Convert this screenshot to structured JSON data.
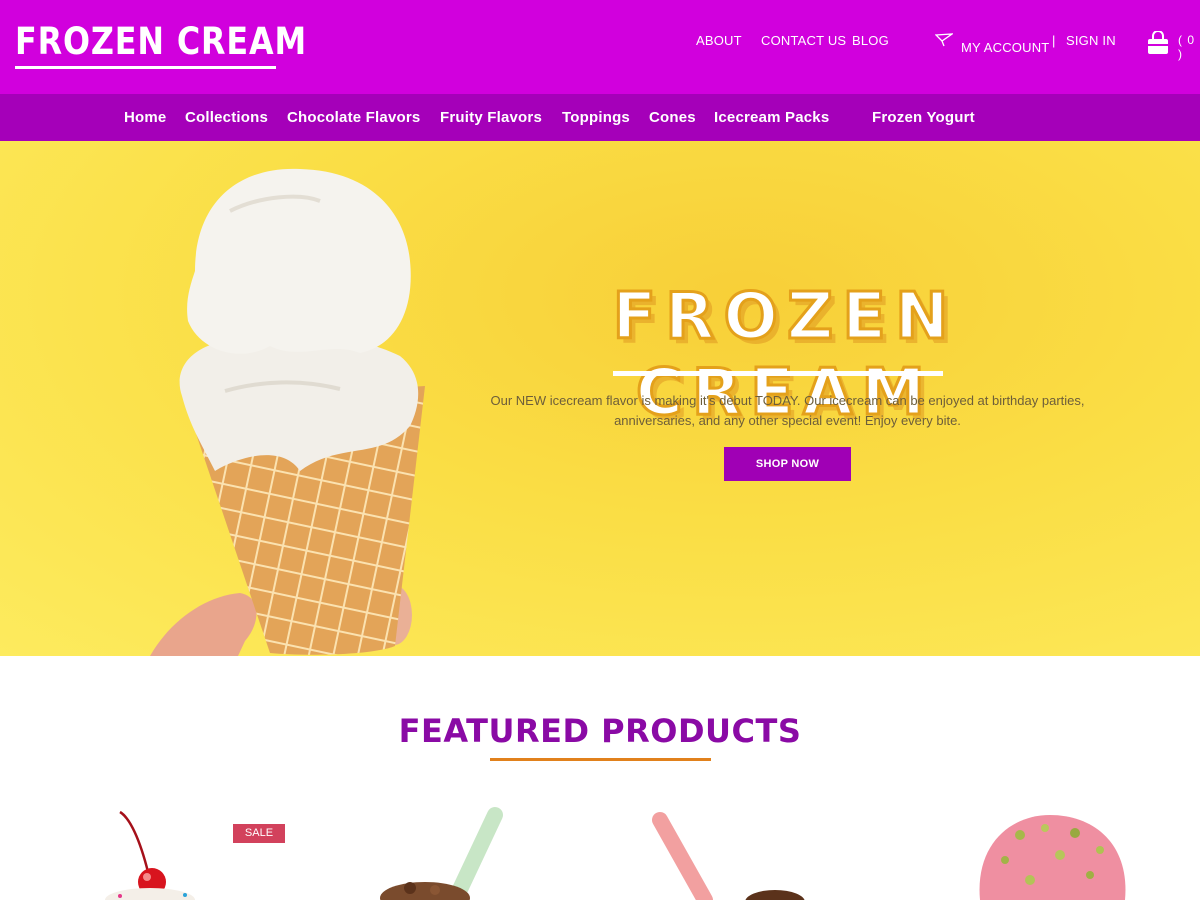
{
  "header": {
    "logo_text": "FROZEN CREAM",
    "links": {
      "about": "ABOUT",
      "contact": "CONTACT US",
      "blog": "BLOG",
      "account": "MY ACCOUNT",
      "separator": "|",
      "signin": "SIGN IN"
    },
    "cart_count": "( 0 )"
  },
  "nav": {
    "items": [
      "Home",
      "Collections",
      "Chocolate Flavors",
      "Fruity Flavors",
      "Toppings",
      "Cones",
      "Icecream Packs",
      "Frozen Yogurt"
    ]
  },
  "hero": {
    "title": "FROZEN CREAM",
    "text_line1": "Our NEW icecream flavor is making it's debut TODAY. Our icecream can be enjoyed at birthday parties,",
    "text_line2": "anniversaries, and any other special event! Enjoy every bite.",
    "button": "SHOP NOW"
  },
  "featured": {
    "title": "FEATURED PRODUCTS",
    "sale_badge": "SALE"
  },
  "colors": {
    "header_bg": "#d100dd",
    "nav_bg": "#a500b9",
    "accent_purple": "#8a0aa5",
    "accent_orange": "#e1811c",
    "sale_red": "#d2415c",
    "hero_yellow": "#fade45"
  }
}
